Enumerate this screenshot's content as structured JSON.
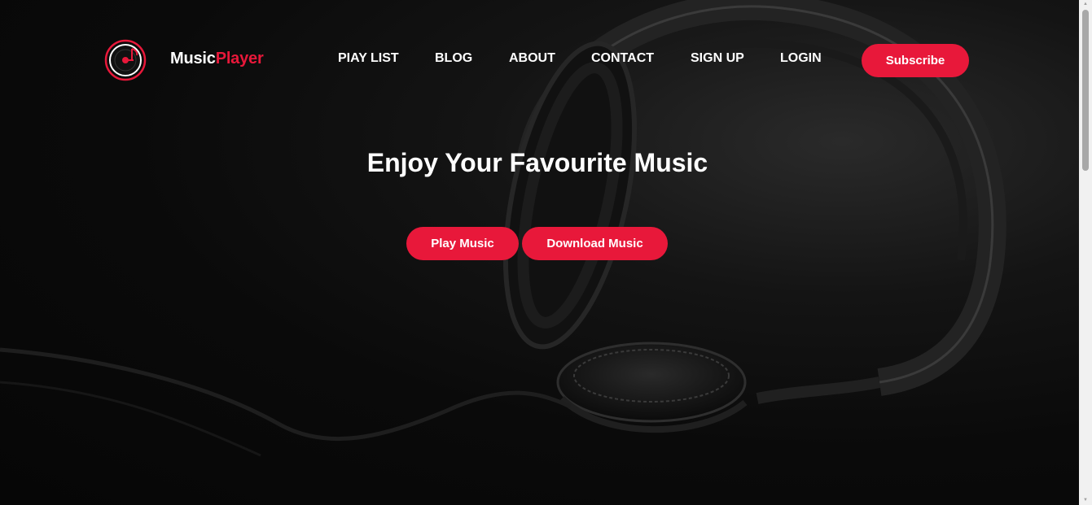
{
  "brand": {
    "name_part1": "Music",
    "name_part2": "Player",
    "logo_icon": "vinyl-music-note-icon"
  },
  "nav": {
    "items": [
      {
        "label": "PIAY LIST"
      },
      {
        "label": "BLOG"
      },
      {
        "label": "ABOUT"
      },
      {
        "label": "CONTACT"
      },
      {
        "label": "SIGN UP"
      },
      {
        "label": "LOGIN"
      }
    ],
    "subscribe_label": "Subscribe"
  },
  "hero": {
    "title": "Enjoy Your Favourite Music",
    "play_label": "Play Music",
    "download_label": "Download Music",
    "background": "headphones-photo"
  },
  "colors": {
    "accent": "#e8183a",
    "background": "#0a0a0a",
    "text": "#ffffff"
  }
}
